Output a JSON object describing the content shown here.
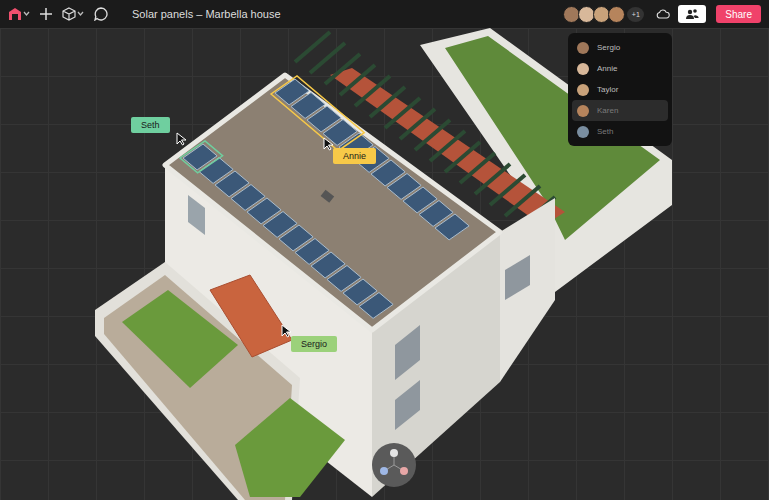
{
  "toolbar": {
    "title": "Solar panels – Marbella house",
    "more_count": "+1",
    "share": "Share"
  },
  "collaborators": [
    {
      "name": "Sergio",
      "selected": false,
      "online": true,
      "color": "#a0785a"
    },
    {
      "name": "Annie",
      "selected": false,
      "online": true,
      "color": "#d8b89a"
    },
    {
      "name": "Taylor",
      "selected": false,
      "online": true,
      "color": "#c9a27a"
    },
    {
      "name": "Karen",
      "selected": true,
      "online": false,
      "color": "#b6845c"
    },
    {
      "name": "Seth",
      "selected": false,
      "online": false,
      "color": "#7a8ea0"
    }
  ],
  "cursors": [
    {
      "name": "Seth",
      "color": "#6fcf9f"
    },
    {
      "name": "Annie",
      "color": "#f7c948"
    },
    {
      "name": "Sergio",
      "color": "#9bd17a"
    }
  ]
}
